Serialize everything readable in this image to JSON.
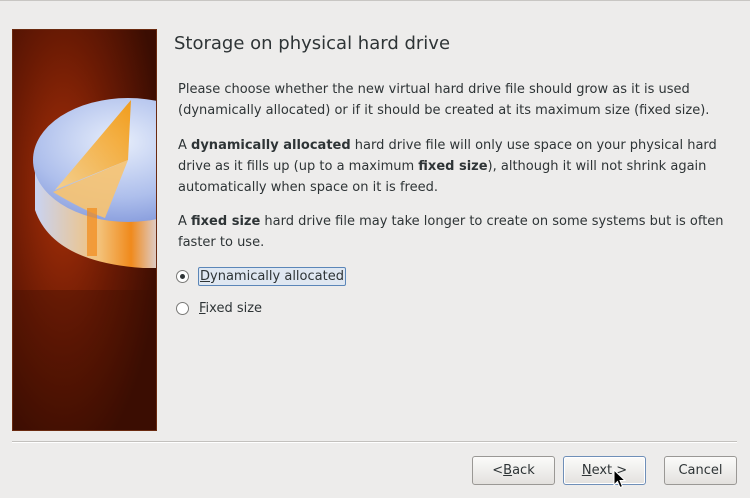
{
  "wizard": {
    "title": "Storage on physical hard drive",
    "paragraphs": {
      "p1": {
        "text": "Please choose whether the new virtual hard drive file should grow as it is used (dynamically allocated) or if it should be created at its maximum size (fixed size)."
      },
      "p2": {
        "t1": "A ",
        "b1": "dynamically allocated",
        "t2": " hard drive file will only use space on your physical hard drive as it fills up (up to a maximum ",
        "b2": "fixed size",
        "t3": "), although it will not shrink again automatically when space on it is freed."
      },
      "p3": {
        "t1": "A ",
        "b1": "fixed size",
        "t2": " hard drive file may take longer to create on some systems but is often faster to use."
      }
    },
    "options": [
      {
        "mnemonic": "D",
        "rest": "ynamically allocated",
        "selected": true
      },
      {
        "mnemonic": "F",
        "rest": "ixed size",
        "selected": false
      }
    ],
    "buttons": {
      "back": {
        "prefix": "< ",
        "mnemonic": "B",
        "rest": "ack"
      },
      "next": {
        "mnemonic": "N",
        "rest": "ext >"
      },
      "cancel": {
        "label": "Cancel"
      }
    }
  },
  "colors": {
    "sidebar_dark": "#3b0d02",
    "sidebar_glow": "#9a2a06",
    "disk_top": "#b9c8ee",
    "disk_slice": "#f5a21e",
    "focus_border": "#5b86b8"
  }
}
